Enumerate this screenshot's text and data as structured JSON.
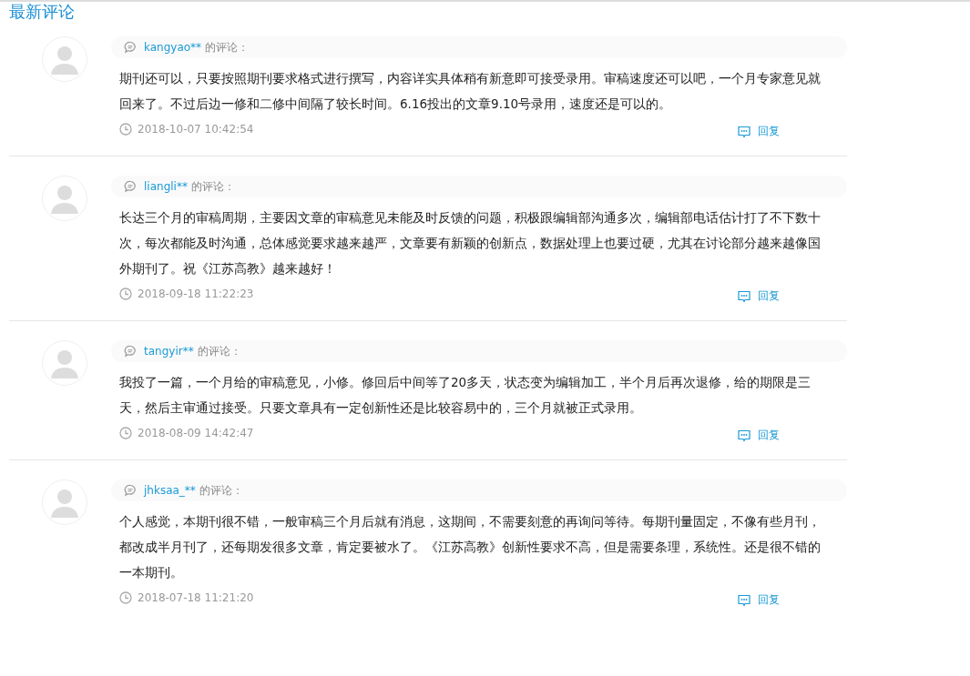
{
  "title": "最新评论",
  "comments": [
    {
      "user": "kangyao**",
      "suffix": "的评论：",
      "body": "期刊还可以，只要按照期刊要求格式进行撰写，内容详实具体稍有新意即可接受录用。审稿速度还可以吧，一个月专家意见就回来了。不过后边一修和二修中间隔了较长时间。6.16投出的文章9.10号录用，速度还是可以的。",
      "time": "2018-10-07 10:42:54",
      "reply": "回复"
    },
    {
      "user": "liangli**",
      "suffix": "的评论：",
      "body": "长达三个月的审稿周期，主要因文章的审稿意见未能及时反馈的问题，积极跟编辑部沟通多次，编辑部电话估计打了不下数十次，每次都能及时沟通，总体感觉要求越来越严，文章要有新颖的创新点，数据处理上也要过硬，尤其在讨论部分越来越像国外期刊了。祝《江苏高教》越来越好！",
      "time": "2018-09-18 11:22:23",
      "reply": "回复"
    },
    {
      "user": "tangyir**",
      "suffix": "的评论：",
      "body": "我投了一篇，一个月给的审稿意见，小修。修回后中间等了20多天，状态变为编辑加工，半个月后再次退修，给的期限是三天，然后主审通过接受。只要文章具有一定创新性还是比较容易中的，三个月就被正式录用。",
      "time": "2018-08-09 14:42:47",
      "reply": "回复"
    },
    {
      "user": "jhksaa_**",
      "suffix": "的评论：",
      "body": "个人感觉，本期刊很不错，一般审稿三个月后就有消息，这期间，不需要刻意的再询问等待。每期刊量固定，不像有些月刊，都改成半月刊了，还每期发很多文章，肯定要被水了。《江苏高教》创新性要求不高，但是需要条理，系统性。还是很不错的一本期刊。",
      "time": "2018-07-18 11:21:20",
      "reply": "回复"
    }
  ]
}
